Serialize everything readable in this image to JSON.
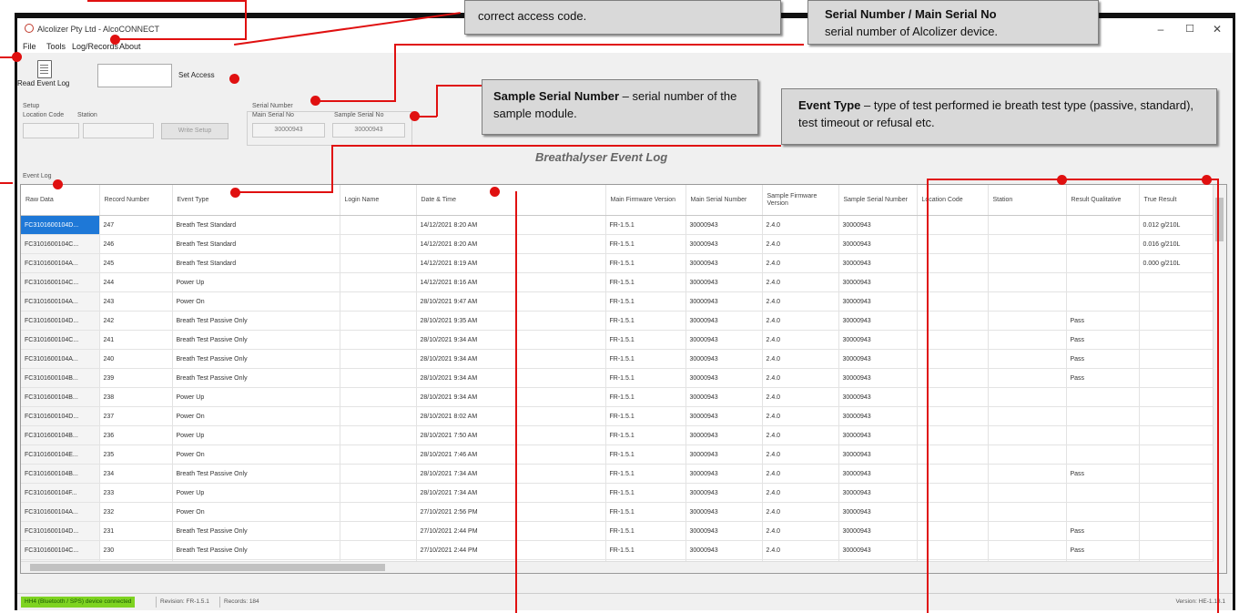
{
  "window": {
    "title": "Alcolizer Pty Ltd  -  AlcoCONNECT",
    "controls": {
      "minimize": "–",
      "maximize": "☐",
      "close": "✕"
    }
  },
  "menu": [
    "File",
    "Tools",
    "Log/Records",
    "About"
  ],
  "toolbar": {
    "read_event_log": "Read Event Log",
    "set_access": "Set Access"
  },
  "setup": {
    "group_label": "Setup",
    "location_code_label": "Location Code",
    "station_label": "Station",
    "write_setup": "Write Setup"
  },
  "serial": {
    "group_label": "Serial Number",
    "main_label": "Main Serial No",
    "sample_label": "Sample Serial No",
    "main_value": "30000943",
    "sample_value": "30000943"
  },
  "event_log_label": "Event Log",
  "caption": "Breathalyser Event Log",
  "table": {
    "columns": [
      "Raw Data",
      "Record Number",
      "Event Type",
      "Login Name",
      "Date & Time",
      "Main Firmware Version",
      "Main Serial Number",
      "Sample Firmware Version",
      "Sample Serial Number",
      "Location Code",
      "Station",
      "Result Qualitative",
      "True Result"
    ],
    "rows": [
      [
        "FC3101600104D...",
        "247",
        "Breath Test Standard",
        "",
        "14/12/2021 8:20 AM",
        "FR-1.5.1",
        "30000943",
        "2.4.0",
        "30000943",
        "",
        "",
        "",
        "0.012 g/210L"
      ],
      [
        "FC3101600104C...",
        "246",
        "Breath Test Standard",
        "",
        "14/12/2021 8:20 AM",
        "FR-1.5.1",
        "30000943",
        "2.4.0",
        "30000943",
        "",
        "",
        "",
        "0.016 g/210L"
      ],
      [
        "FC3101600104A...",
        "245",
        "Breath Test Standard",
        "",
        "14/12/2021 8:19 AM",
        "FR-1.5.1",
        "30000943",
        "2.4.0",
        "30000943",
        "",
        "",
        "",
        "0.000 g/210L"
      ],
      [
        "FC3101600104C...",
        "244",
        "Power Up",
        "",
        "14/12/2021 8:16 AM",
        "FR-1.5.1",
        "30000943",
        "2.4.0",
        "30000943",
        "",
        "",
        "",
        ""
      ],
      [
        "FC3101600104A...",
        "243",
        "Power On",
        "",
        "28/10/2021 9:47 AM",
        "FR-1.5.1",
        "30000943",
        "2.4.0",
        "30000943",
        "",
        "",
        "",
        ""
      ],
      [
        "FC3101600104D...",
        "242",
        "Breath Test Passive Only",
        "",
        "28/10/2021 9:35 AM",
        "FR-1.5.1",
        "30000943",
        "2.4.0",
        "30000943",
        "",
        "",
        "Pass",
        ""
      ],
      [
        "FC3101600104C...",
        "241",
        "Breath Test Passive Only",
        "",
        "28/10/2021 9:34 AM",
        "FR-1.5.1",
        "30000943",
        "2.4.0",
        "30000943",
        "",
        "",
        "Pass",
        ""
      ],
      [
        "FC3101600104A...",
        "240",
        "Breath Test Passive Only",
        "",
        "28/10/2021 9:34 AM",
        "FR-1.5.1",
        "30000943",
        "2.4.0",
        "30000943",
        "",
        "",
        "Pass",
        ""
      ],
      [
        "FC3101600104B...",
        "239",
        "Breath Test Passive Only",
        "",
        "28/10/2021 9:34 AM",
        "FR-1.5.1",
        "30000943",
        "2.4.0",
        "30000943",
        "",
        "",
        "Pass",
        ""
      ],
      [
        "FC3101600104B...",
        "238",
        "Power Up",
        "",
        "28/10/2021 9:34 AM",
        "FR-1.5.1",
        "30000943",
        "2.4.0",
        "30000943",
        "",
        "",
        "",
        ""
      ],
      [
        "FC3101600104D...",
        "237",
        "Power On",
        "",
        "28/10/2021 8:02 AM",
        "FR-1.5.1",
        "30000943",
        "2.4.0",
        "30000943",
        "",
        "",
        "",
        ""
      ],
      [
        "FC3101600104B...",
        "236",
        "Power Up",
        "",
        "28/10/2021 7:50 AM",
        "FR-1.5.1",
        "30000943",
        "2.4.0",
        "30000943",
        "",
        "",
        "",
        ""
      ],
      [
        "FC3101600104E...",
        "235",
        "Power On",
        "",
        "28/10/2021 7:46 AM",
        "FR-1.5.1",
        "30000943",
        "2.4.0",
        "30000943",
        "",
        "",
        "",
        ""
      ],
      [
        "FC3101600104B...",
        "234",
        "Breath Test Passive Only",
        "",
        "28/10/2021 7:34 AM",
        "FR-1.5.1",
        "30000943",
        "2.4.0",
        "30000943",
        "",
        "",
        "Pass",
        ""
      ],
      [
        "FC3101600104F...",
        "233",
        "Power Up",
        "",
        "28/10/2021 7:34 AM",
        "FR-1.5.1",
        "30000943",
        "2.4.0",
        "30000943",
        "",
        "",
        "",
        ""
      ],
      [
        "FC3101600104A...",
        "232",
        "Power On",
        "",
        "27/10/2021 2:56 PM",
        "FR-1.5.1",
        "30000943",
        "2.4.0",
        "30000943",
        "",
        "",
        "",
        ""
      ],
      [
        "FC3101600104D...",
        "231",
        "Breath Test Passive Only",
        "",
        "27/10/2021 2:44 PM",
        "FR-1.5.1",
        "30000943",
        "2.4.0",
        "30000943",
        "",
        "",
        "Pass",
        ""
      ],
      [
        "FC3101600104C...",
        "230",
        "Breath Test Passive Only",
        "",
        "27/10/2021 2:44 PM",
        "FR-1.5.1",
        "30000943",
        "2.4.0",
        "30000943",
        "",
        "",
        "Pass",
        ""
      ],
      [
        "FC3101600104B...",
        "229",
        "Breath Test Passive Only",
        "",
        "27/10/2021 2:44 PM",
        "FR-1.5.1",
        "30000943",
        "2.4.0",
        "30000943",
        "",
        "",
        "Pass",
        ""
      ]
    ]
  },
  "status": {
    "connection": "HH4 (Bluetooth / SPS) device connected",
    "revision": "Revision: FR-1.5.1",
    "records": "Records: 184",
    "version": "Version: HE-1.13.1"
  },
  "annotations": {
    "access_code": {
      "text": "correct access code."
    },
    "serial_number": {
      "title": "Serial Number / Main Serial No",
      "text": "serial number of Alcolizer device."
    },
    "sample_serial": {
      "title": "Sample Serial Number",
      "text": "– serial number of the sample module."
    },
    "event_type": {
      "title": "Event Type",
      "text": "– type of test performed ie breath test type (passive, standard), test timeout or refusal etc."
    }
  },
  "colors": {
    "annotation_red": "#e01010",
    "selection_blue": "#1e78d7",
    "status_green": "#7ed321"
  }
}
